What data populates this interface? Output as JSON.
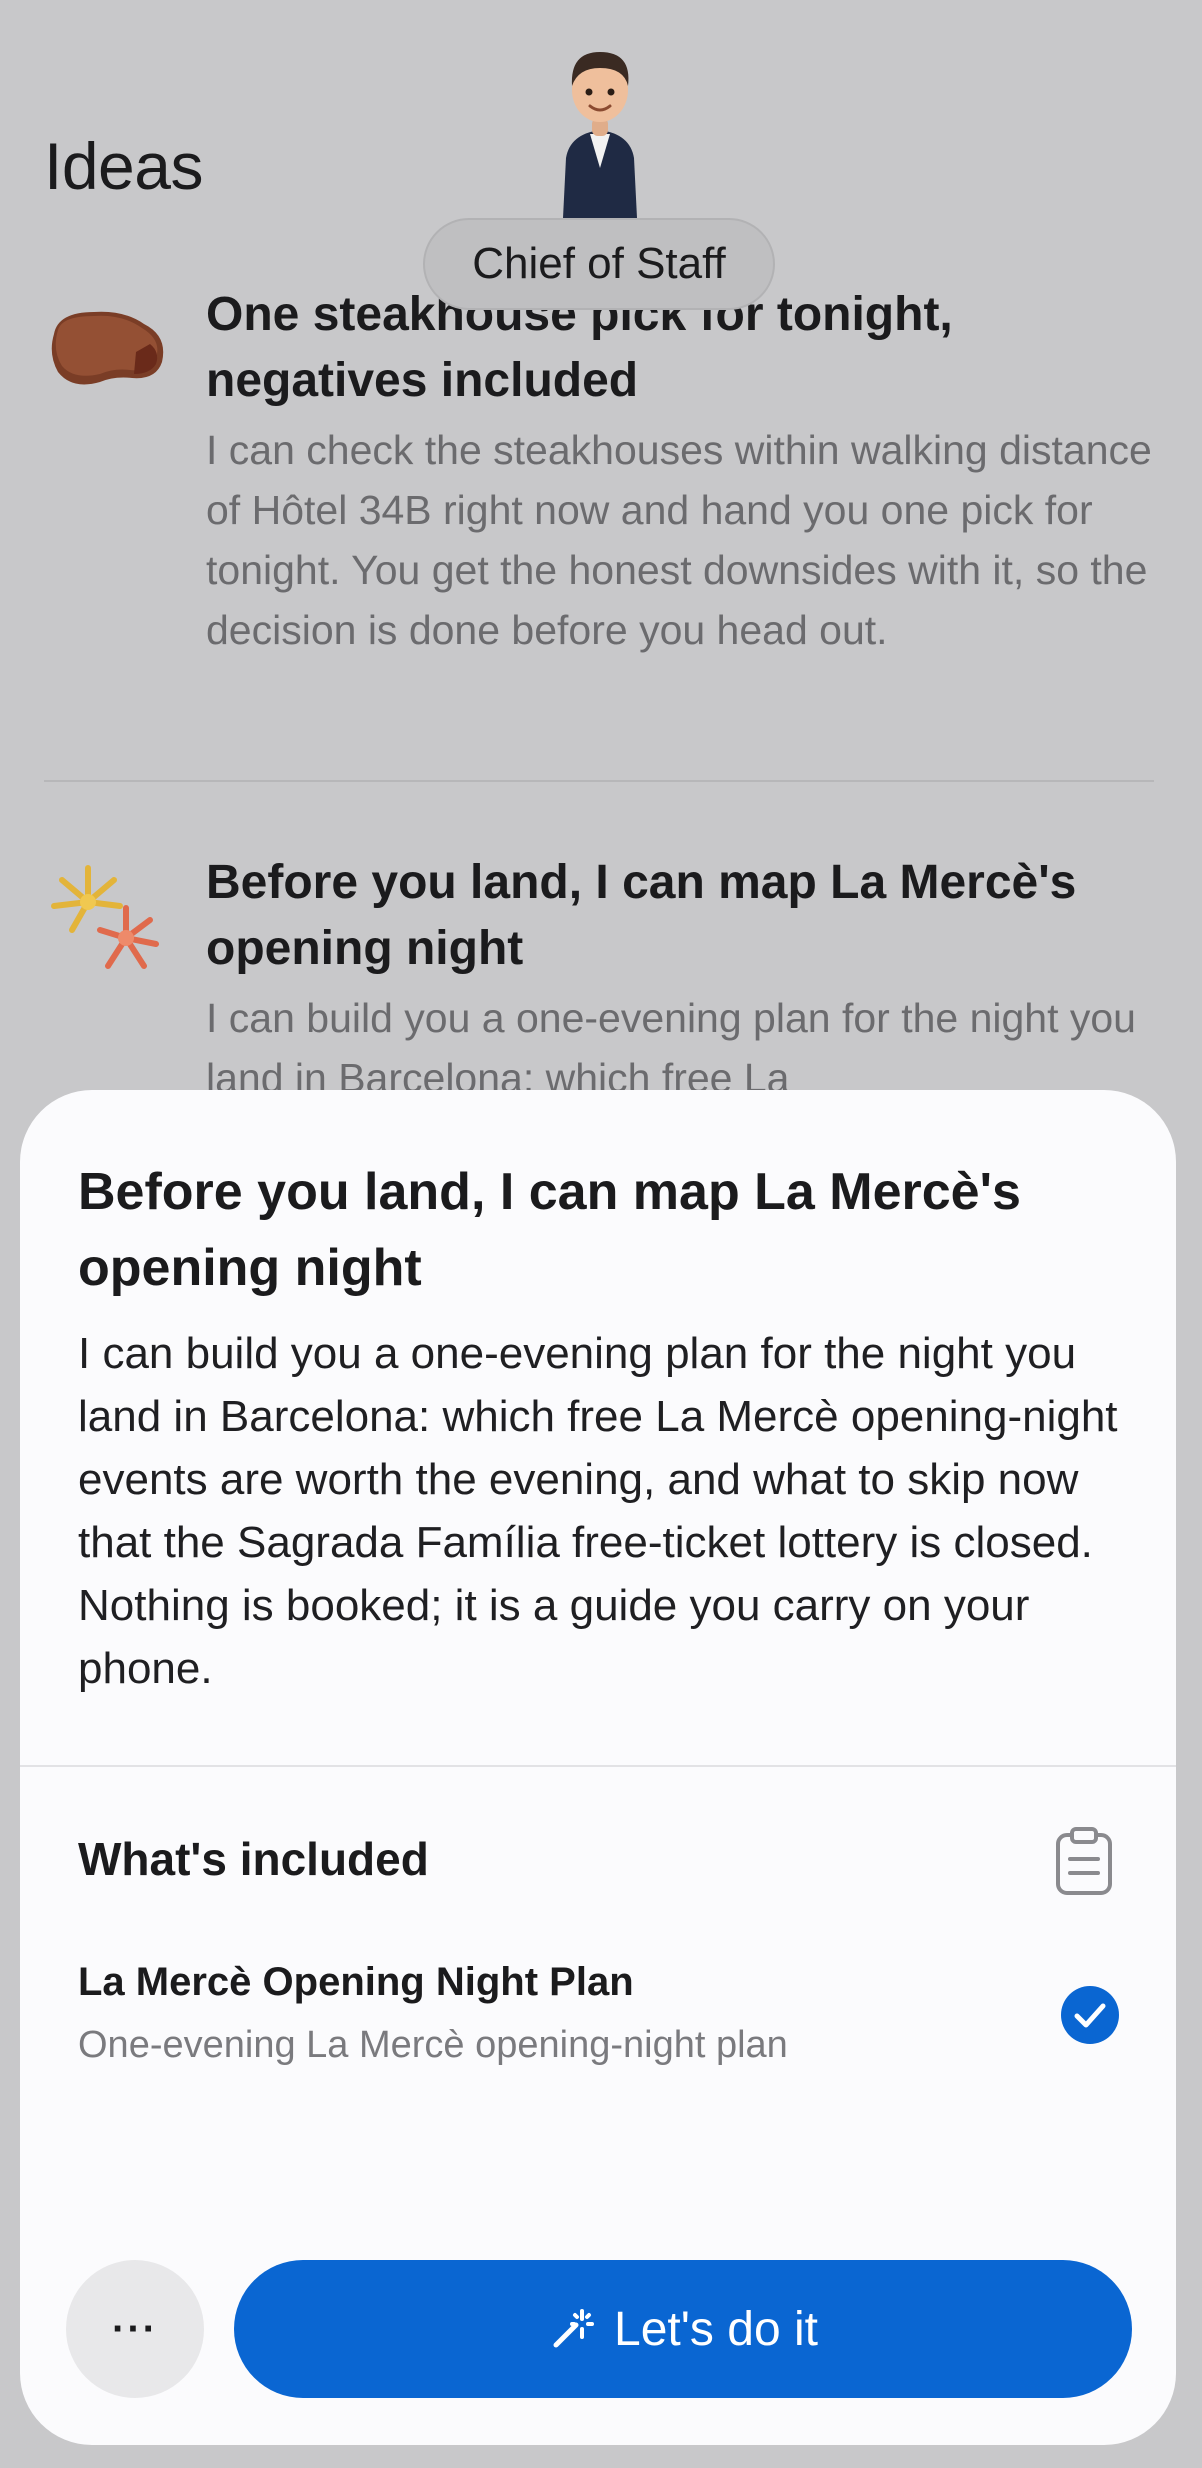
{
  "header": {
    "title": "Ideas",
    "assistant_label": "Chief of Staff"
  },
  "ideas": [
    {
      "icon": "steak-icon",
      "title": "One steakhouse pick for tonight, negatives included",
      "body": "I can check the steakhouses within walking distance of Hôtel 34B right now and hand you one pick for tonight. You get the honest downsides with it, so the decision is done before you head out."
    },
    {
      "icon": "fireworks-icon",
      "title": "Before you land, I can map La Mercè's opening night",
      "body": "I can build you a one-evening plan for the night you land in Barcelona: which free La"
    }
  ],
  "sheet": {
    "title": "Before you land, I can map La Mercè's opening night",
    "body": "I can build you a one-evening plan for the night you land in Barcelona: which free La Mercè opening-night events are worth the evening, and what to skip now that the Sagrada Família free-ticket lottery is closed. Nothing is booked; it is a guide you carry on your phone.",
    "included_label": "What's included",
    "included_item": {
      "name": "La Mercè Opening Night Plan",
      "description": "One-evening La Mercè opening-night plan",
      "checked": true
    },
    "more_label": "···",
    "cta_label": "Let's do it"
  },
  "colors": {
    "accent": "#0a66d2",
    "backdrop": "#c8c8ca",
    "sheet_bg": "#fbfbfd"
  }
}
